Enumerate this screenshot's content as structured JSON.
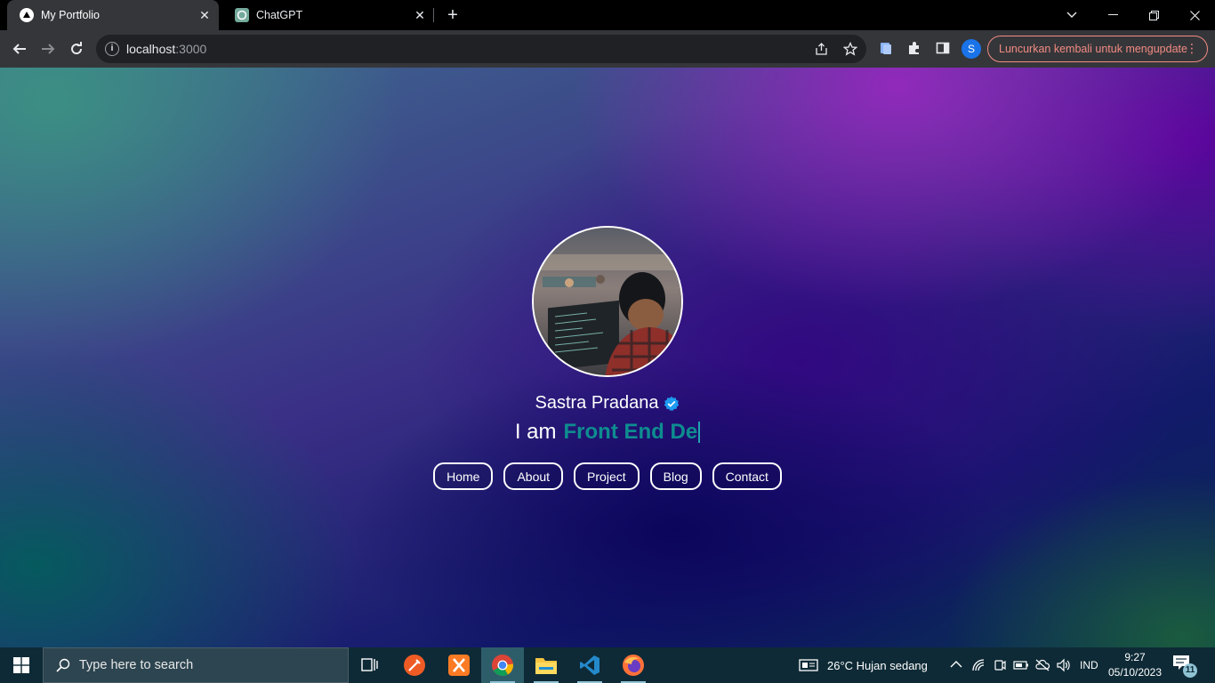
{
  "browser": {
    "tabs": [
      {
        "title": "My Portfolio",
        "favicon": "nextjs-triangle-icon",
        "active": true
      },
      {
        "title": "ChatGPT",
        "favicon": "chatgpt-icon",
        "active": false
      }
    ],
    "url": {
      "host": "localhost",
      "port": ":3000"
    },
    "update_button": "Luncurkan kembali untuk mengupdate",
    "profile_initial": "S"
  },
  "hero": {
    "name": "Sastra Pradana",
    "role_prefix": "I am",
    "role_typed": "Front End De",
    "nav": [
      "Home",
      "About",
      "Project",
      "Blog",
      "Contact"
    ]
  },
  "taskbar": {
    "search_placeholder": "Type here to search",
    "weather": "26°C  Hujan sedang",
    "language": "IND",
    "time": "9:27",
    "date": "05/10/2023",
    "notification_count": "11"
  },
  "colors": {
    "role_accent": "#0e8d8f",
    "verified_badge": "#1d9bf0",
    "update_accent": "#f28b82"
  }
}
